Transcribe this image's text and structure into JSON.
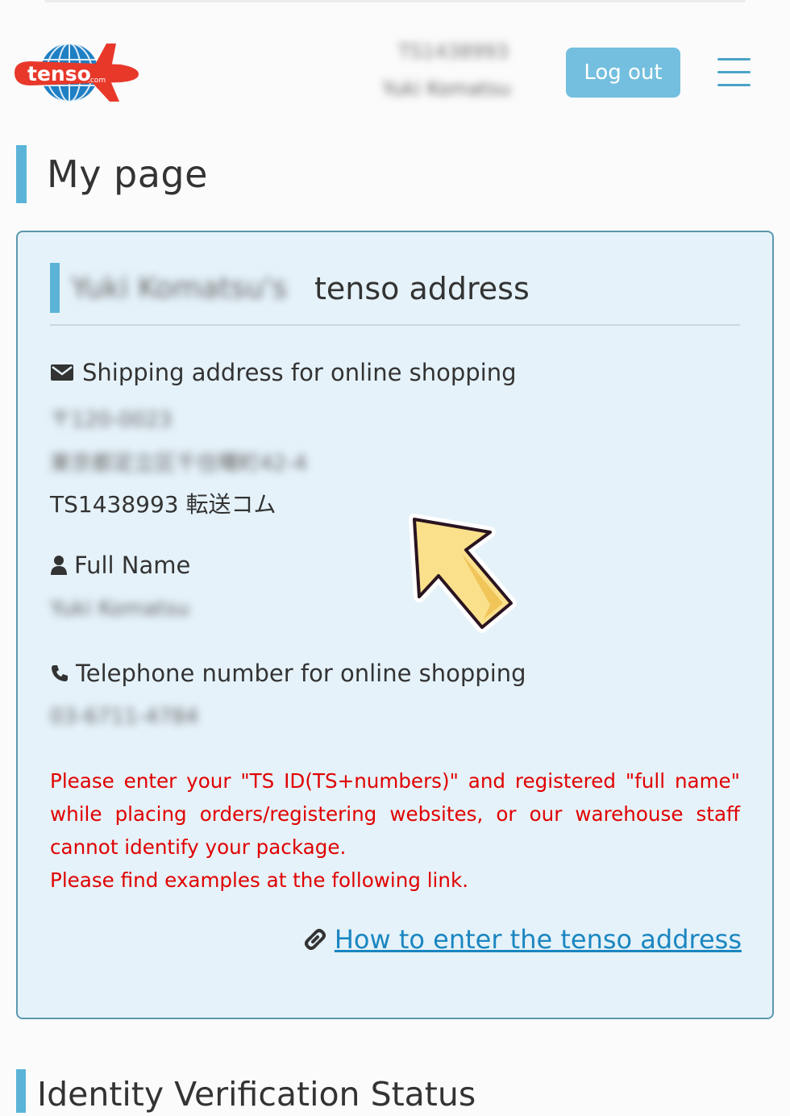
{
  "header": {
    "logo_text": "tenso",
    "logo_suffix": ".com",
    "account_id": "TS1438993",
    "account_name": "Yuki Komatsu",
    "logout_label": "Log out",
    "menu_icon": "hamburger-menu-icon"
  },
  "page": {
    "title": "My page"
  },
  "card": {
    "title_name": "Yuki Komatsu's",
    "title_suffix": "tenso address",
    "shipping": {
      "icon": "envelope-icon",
      "label": "Shipping address for online shopping",
      "postal": "〒120-0023",
      "address": "東京都足立区千住曙町42-4",
      "tsid": "TS1438993 転送コム"
    },
    "fullname": {
      "icon": "person-icon",
      "label": "Full Name",
      "value": "Yuki Komatsu"
    },
    "phone": {
      "icon": "phone-icon",
      "label": "Telephone number for online shopping",
      "value": "03-6711-4784"
    },
    "warning_1": "Please enter your \"TS ID(TS+numbers)\" and registered \"full name\" while placing orders/registering websites, or our warehouse staff cannot identify your package.",
    "warning_2": "Please find examples at the following link.",
    "help_link": {
      "icon": "link-icon",
      "label": "How to enter the tenso address"
    }
  },
  "section2": {
    "title": "Identity Verification Status"
  },
  "colors": {
    "accent": "#5bb4d8",
    "button": "#74bfdf",
    "card_bg": "#e5f2f9",
    "card_border": "#5b98ae",
    "warning": "#e00000",
    "link": "#1a86c1",
    "arrow_fill": "#fbe08c"
  }
}
